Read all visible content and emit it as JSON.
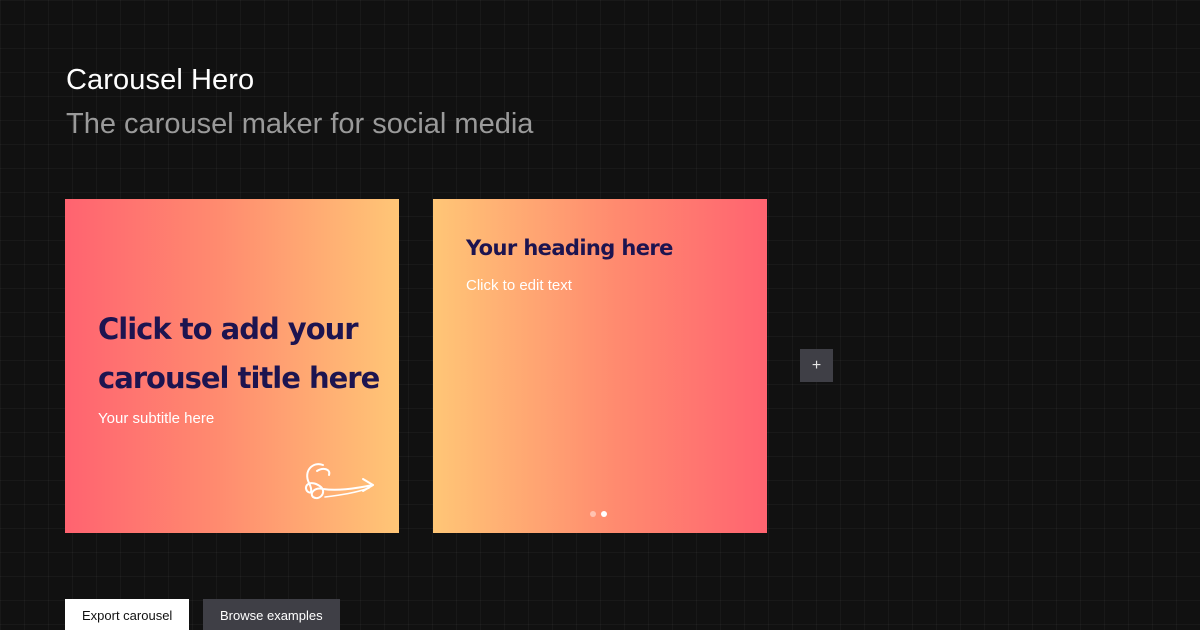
{
  "header": {
    "title": "Carousel Hero",
    "subtitle": "The carousel maker for social media"
  },
  "slides": [
    {
      "title": "Click to add your carousel title here",
      "subtitle": "Your subtitle here",
      "icon": "swipe-arrow-icon"
    },
    {
      "heading": "Your heading here",
      "body": "Click to edit text",
      "pagination": {
        "count": 2,
        "active": 2
      }
    }
  ],
  "add_slide": {
    "label": "+"
  },
  "actions": {
    "export_label": "Export carousel",
    "browse_label": "Browse examples"
  },
  "colors": {
    "background": "#111111",
    "gradient_pink": "#ff6370",
    "gradient_orange": "#ffc676",
    "title_navy": "#1d1450",
    "subtitle_gray": "#9a9a9a",
    "button_dark": "#3f3f46"
  }
}
